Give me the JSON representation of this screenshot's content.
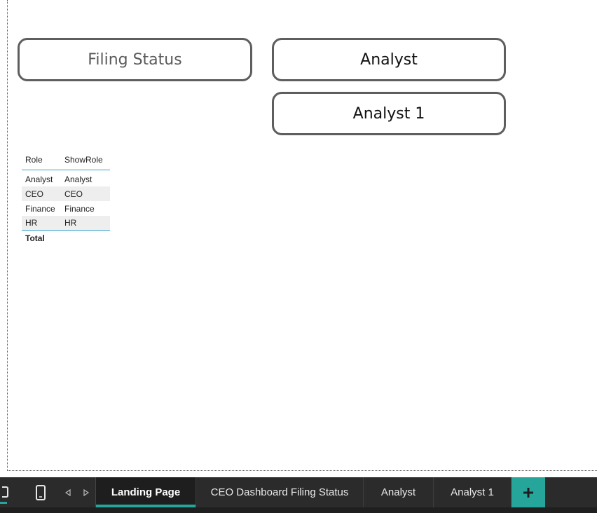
{
  "buttons": {
    "filing_status": "Filing Status",
    "analyst": "Analyst",
    "analyst_1": "Analyst 1"
  },
  "table": {
    "headers": [
      "Role",
      "ShowRole"
    ],
    "rows": [
      [
        "Analyst",
        "Analyst"
      ],
      [
        "CEO",
        "CEO"
      ],
      [
        "Finance",
        "Finance"
      ],
      [
        "HR",
        "HR"
      ]
    ],
    "total_label": "Total"
  },
  "tabs": [
    {
      "label": "Landing Page",
      "active": true
    },
    {
      "label": "CEO Dashboard Filing Status",
      "active": false
    },
    {
      "label": "Analyst",
      "active": false
    },
    {
      "label": "Analyst 1",
      "active": false
    }
  ],
  "icons": {
    "desktop_view": "desktop-icon",
    "mobile_view": "mobile-phone-icon",
    "prev": "chevron-left-icon",
    "next": "chevron-right-icon",
    "add": "plus-icon"
  },
  "colors": {
    "accent": "#26a69a",
    "table_rule": "#3aa0c9",
    "button_border": "#5e5e5e",
    "tabbar_bg": "#2b2b2b"
  }
}
